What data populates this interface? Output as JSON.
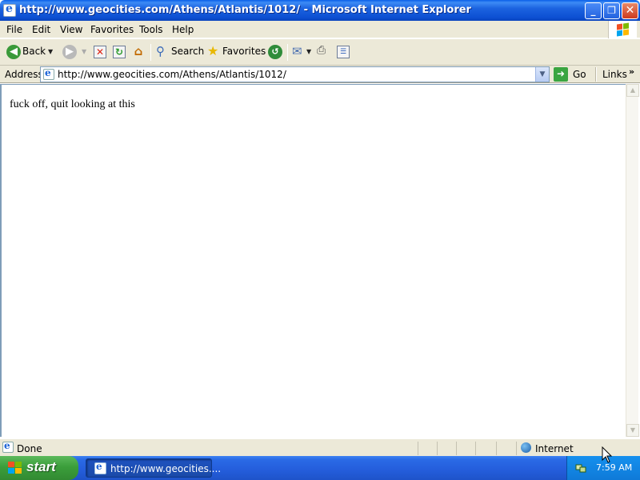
{
  "window": {
    "title": "http://www.geocities.com/Athens/Atlantis/1012/ - Microsoft Internet Explorer",
    "controls": {
      "minimize": "_",
      "maximize": "❐",
      "close": "✕"
    }
  },
  "menubar": {
    "items": [
      "File",
      "Edit",
      "View",
      "Favorites",
      "Tools",
      "Help"
    ]
  },
  "toolbar": {
    "back_label": "Back",
    "search_label": "Search",
    "favorites_label": "Favorites"
  },
  "address_bar": {
    "label": "Address",
    "url": "http://www.geocities.com/Athens/Atlantis/1012/",
    "go_label": "Go",
    "links_label": "Links"
  },
  "page": {
    "text": "fuck off, quit looking at this"
  },
  "statusbar": {
    "status": "Done",
    "zone": "Internet"
  },
  "taskbar": {
    "start_label": "start",
    "task_label": "http://www.geocities....",
    "clock": "7:59 AM"
  },
  "colors": {
    "titlebar_blue": "#0c4fd2",
    "start_green": "#3b9e3b",
    "chrome_beige": "#ece9d8",
    "address_border": "#7f9db9"
  }
}
